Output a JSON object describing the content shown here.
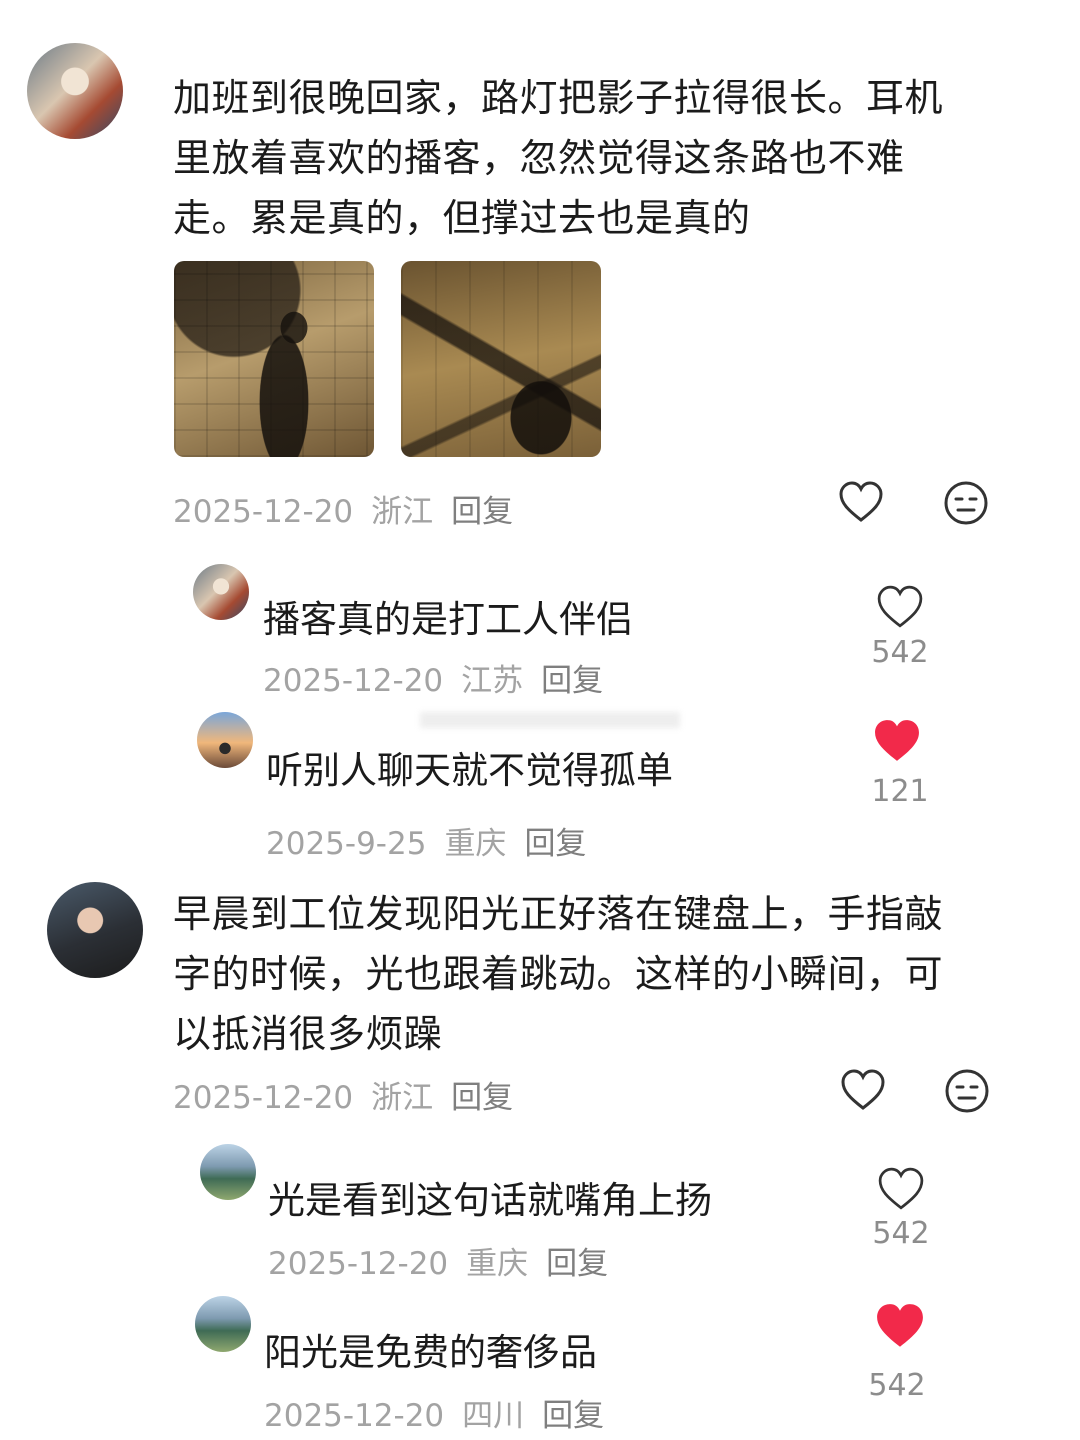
{
  "comments": [
    {
      "text": "加班到很晚回家，路灯把影子拉得很长。耳机里放着喜欢的播客，忽然觉得这条路也不难走。累是真的，但撑过去也是真的",
      "date": "2025-12-20",
      "location": "浙江",
      "reply_label": "回复",
      "replies": [
        {
          "text": "播客真的是打工人伴侣",
          "date": "2025-12-20",
          "location": "江苏",
          "reply_label": "回复",
          "likes": "542",
          "liked": false
        },
        {
          "text": "听别人聊天就不觉得孤单",
          "date": "2025-9-25",
          "location": "重庆",
          "reply_label": "回复",
          "likes": "121",
          "liked": true
        }
      ]
    },
    {
      "text": "早晨到工位发现阳光正好落在键盘上，手指敲字的时候，光也跟着跳动。这样的小瞬间，可以抵消很多烦躁",
      "date": "2025-12-20",
      "location": "浙江",
      "reply_label": "回复",
      "replies": [
        {
          "text": "光是看到这句话就嘴角上扬",
          "date": "2025-12-20",
          "location": "重庆",
          "reply_label": "回复",
          "likes": "542",
          "liked": false
        },
        {
          "text": "阳光是免费的奢侈品",
          "date": "2025-12-20",
          "location": "四川",
          "reply_label": "回复",
          "likes": "542",
          "liked": true
        }
      ]
    }
  ],
  "colors": {
    "liked_heart": "#f2294a",
    "meta_gray": "#a3a3a3",
    "icon_gray": "#333333"
  },
  "icons": [
    "heart-outline-icon",
    "neutral-face-icon",
    "heart-filled-icon"
  ]
}
